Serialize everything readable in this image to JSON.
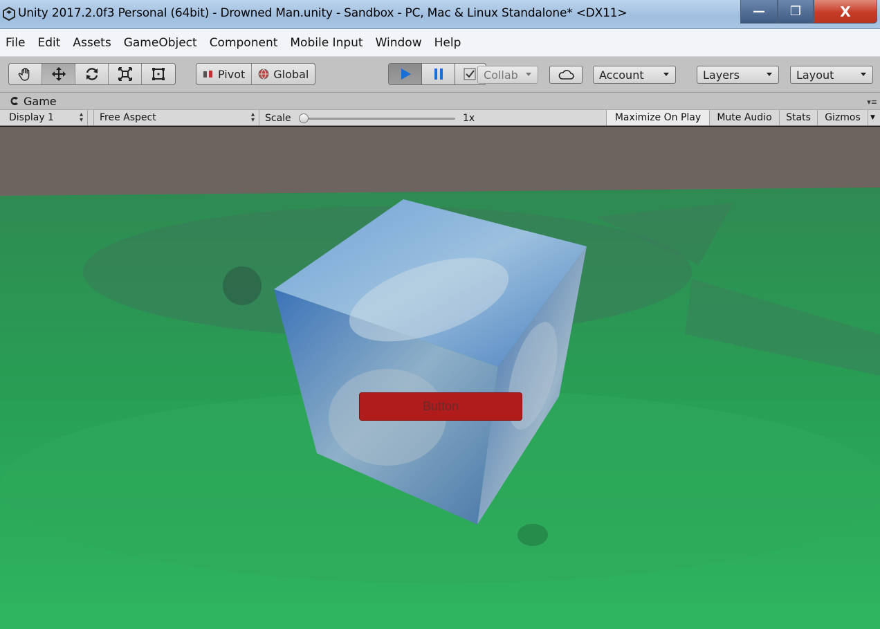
{
  "window": {
    "title": "Unity 2017.2.0f3 Personal (64bit) - Drowned Man.unity - Sandbox - PC, Mac & Linux Standalone* <DX11>",
    "minimize_glyph": "—",
    "maximize_glyph": "❐",
    "close_glyph": "X"
  },
  "menubar": {
    "items": [
      "File",
      "Edit",
      "Assets",
      "GameObject",
      "Component",
      "Mobile Input",
      "Window",
      "Help"
    ]
  },
  "toolbar": {
    "tools": [
      "hand-tool-icon",
      "move-tool-icon",
      "rotate-tool-icon",
      "scale-tool-icon",
      "rect-tool-icon"
    ],
    "pivot_label": "Pivot",
    "global_label": "Global",
    "collab_label": "Collab",
    "account_label": "Account",
    "layers_label": "Layers",
    "layout_label": "Layout"
  },
  "game_view": {
    "tab_label": "Game",
    "display": "Display 1",
    "aspect": "Free Aspect",
    "scale_label": "Scale",
    "scale_value": "1x",
    "scale_level": 0,
    "maximize_on_play": "Maximize On Play",
    "mute_audio": "Mute Audio",
    "stats": "Stats",
    "gizmos": "Gizmos",
    "maximize_on_play_active": true
  },
  "scene": {
    "button_label": "Button",
    "button_color": "#b01b1b",
    "background_color": "#6d6460",
    "ground_color": "#2aa85a"
  }
}
